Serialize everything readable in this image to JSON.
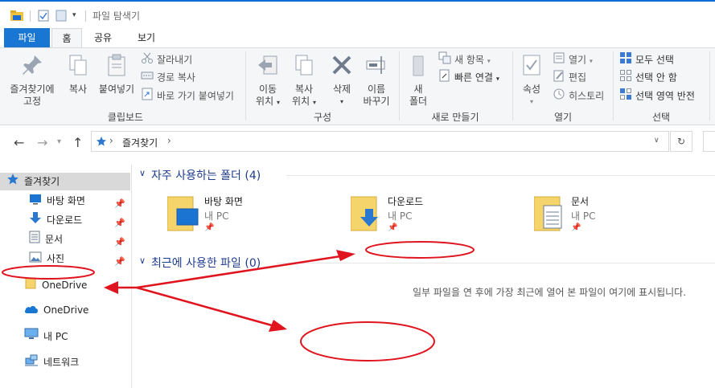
{
  "window": {
    "title": "파일 탐색기"
  },
  "ribbon_tabs": [
    {
      "label": "파일",
      "kind": "file"
    },
    {
      "label": "홈",
      "kind": "active"
    },
    {
      "label": "공유",
      "kind": "normal"
    },
    {
      "label": "보기",
      "kind": "normal"
    }
  ],
  "ribbon": {
    "clipboard": {
      "group_label": "클립보드",
      "pin_label_1": "즐겨찾기에",
      "pin_label_2": "고정",
      "copy_label": "복사",
      "paste_label": "붙여넣기",
      "cut_label": "잘라내기",
      "copy_path_label": "경로 복사",
      "paste_shortcut_label": "바로 가기 붙여넣기"
    },
    "organize": {
      "group_label": "구성",
      "move_1": "이동",
      "move_2": "위치",
      "copyto_1": "복사",
      "copyto_2": "위치",
      "delete_label": "삭제",
      "rename_1": "이름",
      "rename_2": "바꾸기"
    },
    "new": {
      "group_label": "새로 만들기",
      "newfolder_1": "새",
      "newfolder_2": "폴더",
      "new_item_label": "새 항목",
      "easy_access_label": "빠른 연결"
    },
    "open": {
      "group_label": "열기",
      "properties_label": "속성",
      "open_label": "열기",
      "edit_label": "편집",
      "history_label": "히스토리"
    },
    "select": {
      "group_label": "선택",
      "select_all_label": "모두 선택",
      "select_none_label": "선택 안 함",
      "invert_label": "선택 영역 반전"
    }
  },
  "address": {
    "path_label": "즐겨찾기",
    "refresh_icon": "refresh-icon"
  },
  "sidebar": {
    "items": [
      {
        "label": "즐겨찾기",
        "icon": "star-icon",
        "pinned": false
      },
      {
        "label": "바탕 화면",
        "icon": "desktop-icon",
        "pinned": true
      },
      {
        "label": "다운로드",
        "icon": "download-icon",
        "pinned": true
      },
      {
        "label": "문서",
        "icon": "document-icon",
        "pinned": true
      },
      {
        "label": "사진",
        "icon": "picture-icon",
        "pinned": true
      },
      {
        "label": "OneDrive",
        "icon": "folder-icon",
        "pinned": false
      },
      {
        "label": "OneDrive",
        "icon": "cloud-icon",
        "pinned": false
      },
      {
        "label": "내 PC",
        "icon": "computer-icon",
        "pinned": false
      },
      {
        "label": "네트워크",
        "icon": "network-icon",
        "pinned": false
      }
    ]
  },
  "frequent": {
    "header": "자주 사용하는 폴더 (4)",
    "folders": [
      {
        "name": "바탕 화면",
        "location": "내 PC"
      },
      {
        "name": "다운로드",
        "location": "내 PC"
      },
      {
        "name": "문서",
        "location": "내 PC"
      }
    ]
  },
  "recent": {
    "header": "최근에 사용한 파일 (0)",
    "empty_message": "일부 파일을 연 후에 가장 최근에 열어 본 파일이 여기에 표시됩니다."
  },
  "colors": {
    "accent": "#1976d2",
    "annotation": "#e0141e",
    "folder": "#f5c542"
  }
}
